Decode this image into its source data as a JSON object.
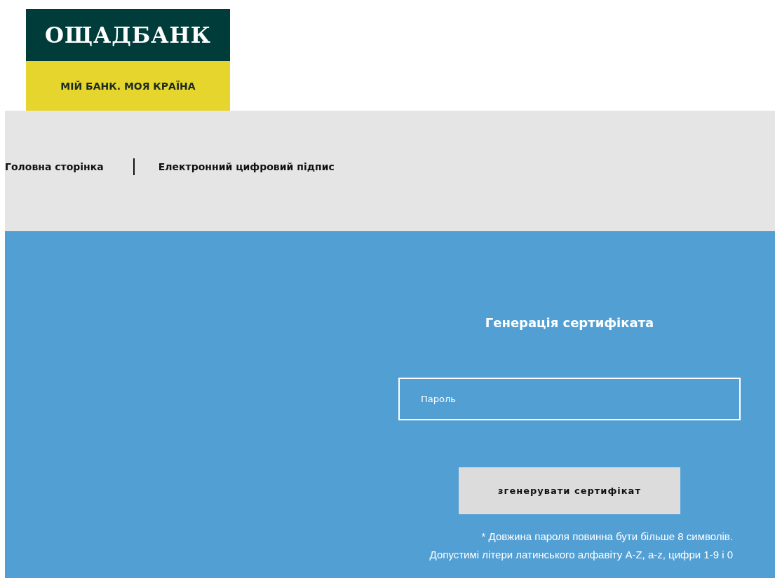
{
  "logo": {
    "name": "ОЩАДБАНК",
    "slogan": "МІЙ БАНК. МОЯ КРАЇНА"
  },
  "nav": [
    {
      "label": "Головна сторінка"
    },
    {
      "label": "Електронний цифровий підпис"
    }
  ],
  "form": {
    "title": "Генерація сертифіката",
    "password": {
      "placeholder": "Пароль"
    },
    "button": "згенерувати сертифікат",
    "notes": [
      "* Довжина пароля повинна бути більше 8 символів.",
      "Допустимі літери латинського алфавіту A-Z, a-z, цифри 1-9 і 0"
    ]
  }
}
